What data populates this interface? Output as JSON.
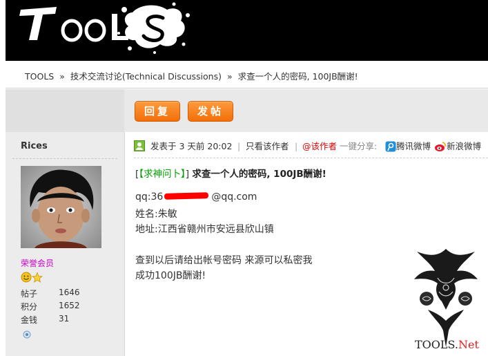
{
  "header": {
    "logo_alt": "TOOLS"
  },
  "breadcrumb": {
    "items": [
      "TOOLS",
      "技术交流讨论(Technical Discussions)",
      "求查一个人的密码, 100JB酬谢!"
    ],
    "separator": "»"
  },
  "toolbar": {
    "reply_label": "回复",
    "post_label": "发帖"
  },
  "user": {
    "name": "Rices",
    "group": "荣誉会员",
    "stats": [
      {
        "label": "帖子",
        "value": "1646"
      },
      {
        "label": "积分",
        "value": "1652"
      },
      {
        "label": "金钱",
        "value": "31"
      }
    ]
  },
  "post_meta": {
    "posted": "发表于 3 天前 20:02",
    "only_author": "只看该作者",
    "at_author": "@该作者",
    "share_label": "一键分享:",
    "share_tencent": "腾讯微博",
    "share_sina": "新浪微博"
  },
  "post": {
    "tag": "【求神问卜】",
    "title": "求查一个人的密码, 100JB酬谢!",
    "qq_prefix": "qq:36",
    "qq_suffix": "@qq.com",
    "name_line": "姓名:朱敏",
    "address_line": "地址:江西省赣州市安远县欣山镇",
    "request_line": "查到以后请给出帐号密码 来源可以私密我",
    "thanks_line": "成功100JB酬谢!"
  },
  "watermark": {
    "text_a": "T",
    "text_b": "OOLS.",
    "text_c": "Net"
  },
  "colors": {
    "accent": "#f26f0a",
    "usergroup": "#cc00cc",
    "tag": "#00a000",
    "at_author": "#e00000"
  }
}
